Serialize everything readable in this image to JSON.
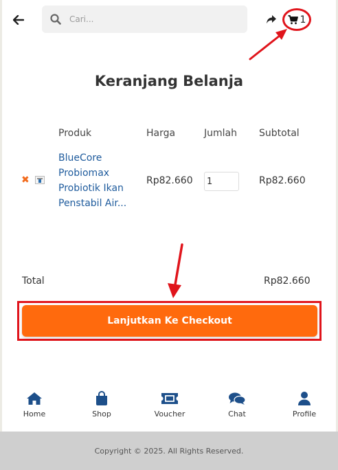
{
  "header": {
    "search_placeholder": "Cari...",
    "cart_count": "1"
  },
  "page_title": "Keranjang Belanja",
  "table": {
    "headers": [
      "Produk",
      "Harga",
      "Jumlah",
      "Subtotal"
    ],
    "rows": [
      {
        "product_lines": [
          "BlueCore",
          "Probiomax",
          "Probiotik Ikan",
          "Penstabil Air..."
        ],
        "price": "Rp82.660",
        "quantity": "1",
        "subtotal": "Rp82.660"
      }
    ]
  },
  "summary": {
    "total_label": "Total",
    "total_value": "Rp82.660"
  },
  "checkout_label": "Lanjutkan Ke Checkout",
  "bottom_nav": [
    {
      "label": "Home",
      "icon": "home-icon"
    },
    {
      "label": "Shop",
      "icon": "shopping-bag-icon"
    },
    {
      "label": "Voucher",
      "icon": "ticket-icon"
    },
    {
      "label": "Chat",
      "icon": "chat-icon"
    },
    {
      "label": "Profile",
      "icon": "user-icon"
    }
  ],
  "footer_text": "Copyright © 2025. All Rights Reserved.",
  "colors": {
    "accent": "#ff6a0d",
    "link": "#1d5a9c",
    "nav_icon": "#1d4f8a",
    "annotation": "#e0141b"
  }
}
